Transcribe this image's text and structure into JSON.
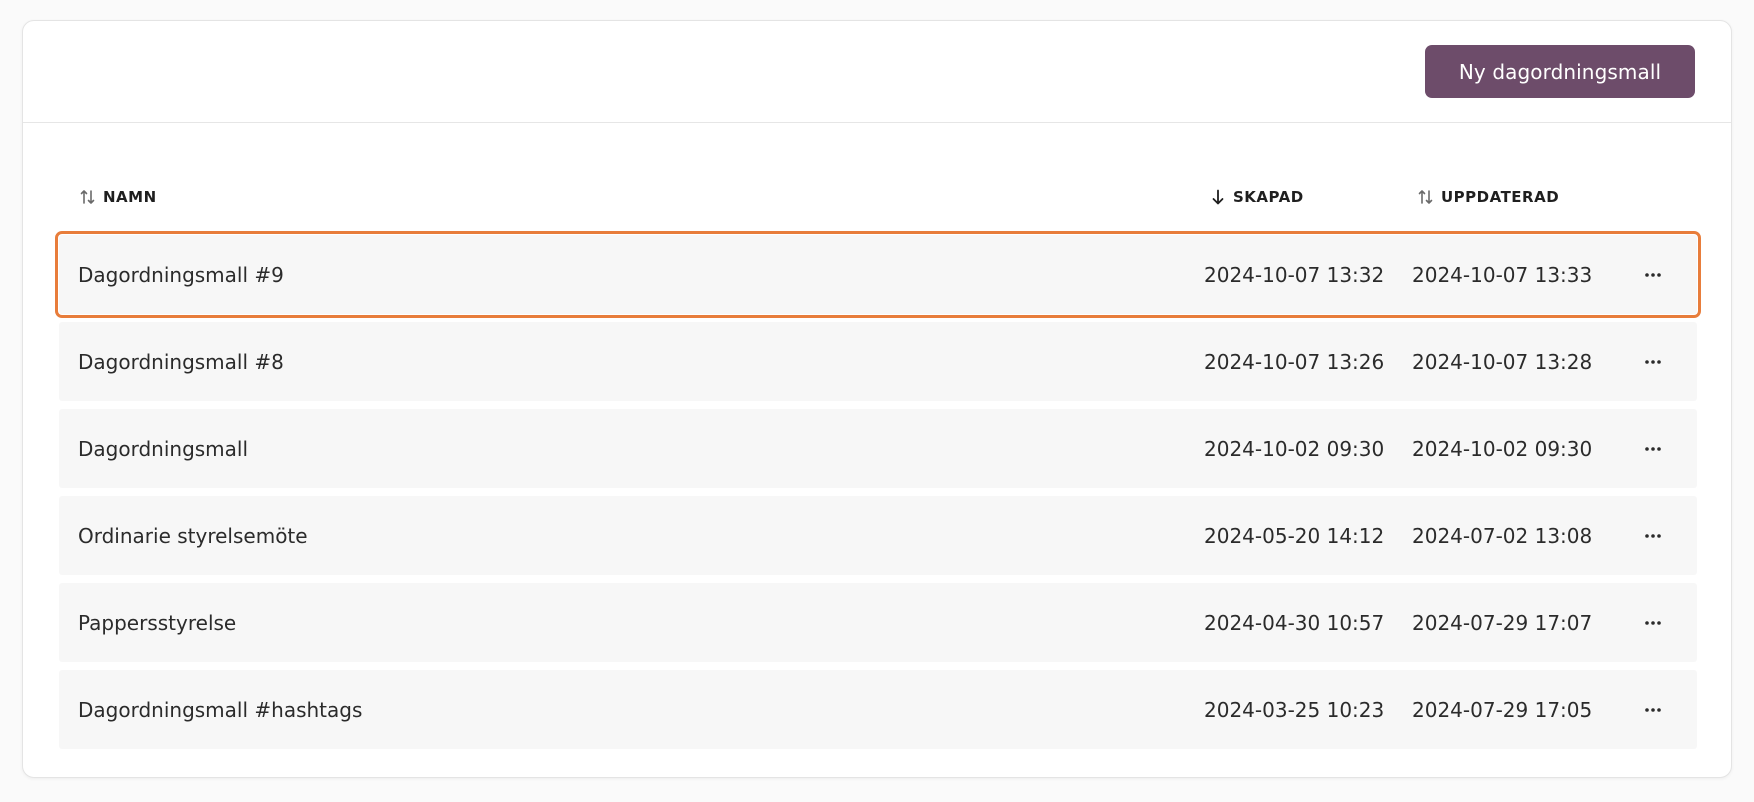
{
  "header": {
    "new_button_label": "Ny dagordningsmall"
  },
  "colors": {
    "primary": "#6d4c6a",
    "selection_outline": "#e87d3b",
    "row_background": "#f7f7f7"
  },
  "table": {
    "columns": {
      "name": {
        "label": "NAMN",
        "icon": "sort-both-icon"
      },
      "created": {
        "label": "SKAPAD",
        "icon": "sort-desc-icon"
      },
      "updated": {
        "label": "UPPDATERAD",
        "icon": "sort-both-icon"
      }
    },
    "rows": [
      {
        "name": "Dagordningsmall #9",
        "created": "2024-10-07 13:32",
        "updated": "2024-10-07 13:33",
        "selected": true
      },
      {
        "name": "Dagordningsmall #8",
        "created": "2024-10-07 13:26",
        "updated": "2024-10-07 13:28",
        "selected": false
      },
      {
        "name": "Dagordningsmall",
        "created": "2024-10-02 09:30",
        "updated": "2024-10-02 09:30",
        "selected": false
      },
      {
        "name": "Ordinarie styrelsemöte",
        "created": "2024-05-20 14:12",
        "updated": "2024-07-02 13:08",
        "selected": false
      },
      {
        "name": "Pappersstyrelse",
        "created": "2024-04-30 10:57",
        "updated": "2024-07-29 17:07",
        "selected": false
      },
      {
        "name": "Dagordningsmall #hashtags",
        "created": "2024-03-25 10:23",
        "updated": "2024-07-29 17:05",
        "selected": false
      }
    ]
  }
}
